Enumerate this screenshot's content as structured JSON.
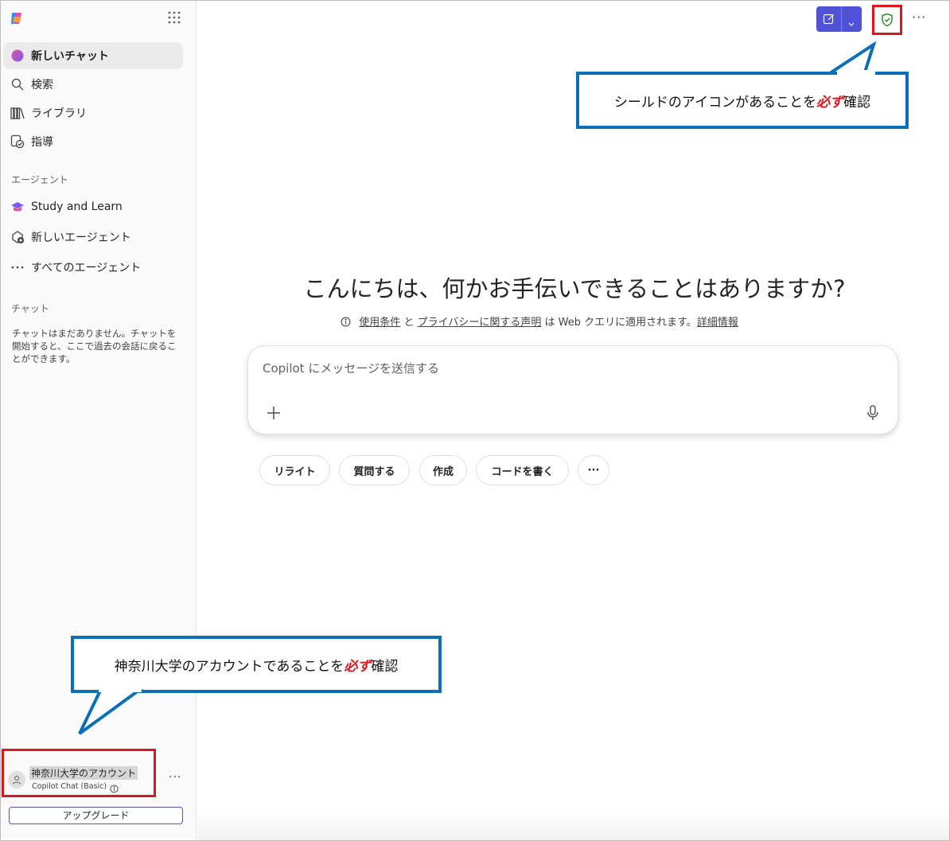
{
  "sidebar": {
    "logo": "copilot-logo",
    "apps_icon": "app-launcher-icon",
    "items": [
      {
        "label": "新しいチャット",
        "icon": "new-chat-icon",
        "active": true
      },
      {
        "label": "検索",
        "icon": "search-icon"
      },
      {
        "label": "ライブラリ",
        "icon": "library-icon"
      },
      {
        "label": "指導",
        "icon": "guidance-icon"
      }
    ],
    "agents_label": "エージェント",
    "agents": [
      {
        "label": "Study and Learn",
        "icon": "graduation-cap-icon"
      },
      {
        "label": "新しいエージェント",
        "icon": "new-agent-icon"
      },
      {
        "label": "すべてのエージェント",
        "icon": "more-horizontal-icon"
      }
    ],
    "chat_label": "チャット",
    "empty_text": "チャットはまだありません。チャットを開始すると、ここで過去の会話に戻ることができます。",
    "account": {
      "name": "神奈川大学のアカウント",
      "plan": "Copilot Chat (Basic)",
      "more": "···"
    },
    "upgrade_label": "アップグレード"
  },
  "topbar": {
    "more": "···"
  },
  "main": {
    "greeting": "こんにちは、何かお手伝いできることはありますか?",
    "terms": {
      "link1": "使用条件",
      "and": "と",
      "link2": "プライバシーに関する声明",
      "middle": "は Web クエリに適用されます。",
      "link3": "詳細情報"
    },
    "composer_placeholder": "Copilot にメッセージを送信する",
    "chips": [
      "リライト",
      "質問する",
      "作成",
      "コードを書く",
      "···"
    ]
  },
  "callouts": {
    "shield": {
      "before": "シールドのアイコンがあることを",
      "must": "必ず",
      "after": "確認"
    },
    "account": {
      "before": "神奈川大学のアカウントであることを",
      "must": "必ず",
      "after": "確認"
    }
  },
  "colors": {
    "accent": "#4f52d6",
    "highlight_red": "#e0161e",
    "callout_blue": "#0b6fb8",
    "shield_green": "#107c10"
  }
}
